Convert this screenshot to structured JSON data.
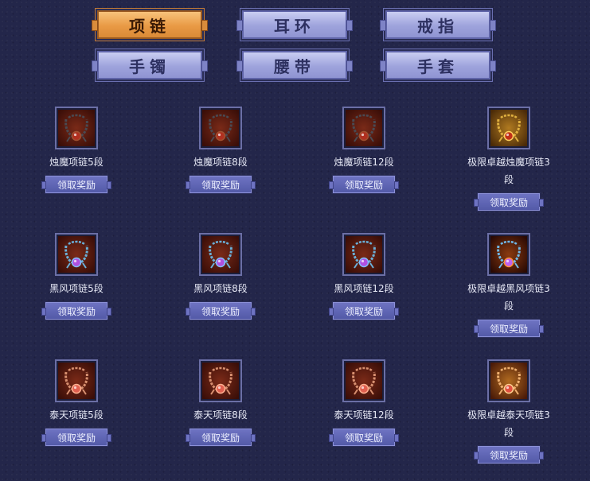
{
  "tabs": [
    {
      "label": "项链",
      "active": true
    },
    {
      "label": "耳环",
      "active": false
    },
    {
      "label": "戒指",
      "active": false
    },
    {
      "label": "手镯",
      "active": false
    },
    {
      "label": "腰带",
      "active": false
    },
    {
      "label": "手套",
      "active": false
    }
  ],
  "claim_label": "领取奖励",
  "rewards": [
    {
      "name": "烛魔项链5段",
      "icon": "necklace-dark-icon"
    },
    {
      "name": "烛魔项链8段",
      "icon": "necklace-dark-icon"
    },
    {
      "name": "烛魔项链12段",
      "icon": "necklace-dark-icon"
    },
    {
      "name": "极限卓越烛魔项链3段",
      "icon": "necklace-gold-icon"
    },
    {
      "name": "黑风项链5段",
      "icon": "necklace-blue-icon"
    },
    {
      "name": "黑风项链8段",
      "icon": "necklace-blue-icon"
    },
    {
      "name": "黑风项链12段",
      "icon": "necklace-blue-icon"
    },
    {
      "name": "极限卓越黑风项链3段",
      "icon": "necklace-blue-fire-icon"
    },
    {
      "name": "泰天项链5段",
      "icon": "necklace-rose-icon"
    },
    {
      "name": "泰天项链8段",
      "icon": "necklace-rose-icon"
    },
    {
      "name": "泰天项链12段",
      "icon": "necklace-rose-icon"
    },
    {
      "name": "极限卓越泰天项链3段",
      "icon": "necklace-rose-gold-icon"
    }
  ],
  "colors": {
    "background": "#23264a",
    "tab_active": "#e99a45",
    "tab_inactive": "#9ea3dc",
    "button": "#5d63b2"
  }
}
